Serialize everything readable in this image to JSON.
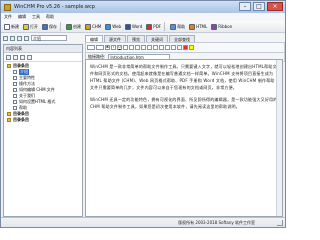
{
  "window": {
    "title": "WinCHM Pro v5.26 - sample.wcp"
  },
  "menu": [
    "文件",
    "编辑",
    "工具",
    "帮助"
  ],
  "toolbar": [
    "新建",
    "打开",
    "保存",
    "",
    "创建",
    "CHM",
    "Web",
    "Word",
    "PDF",
    "",
    "帮助",
    "HTML",
    "Ribbon"
  ],
  "sub_toolbar": {
    "address_value": "介绍"
  },
  "left_panel": {
    "title": "内容列表",
    "tree": [
      {
        "label": "目录条目",
        "type": "folder",
        "level": 0,
        "bold": true
      },
      {
        "label": "介绍",
        "type": "page",
        "level": 1,
        "selected": true
      },
      {
        "label": "主要特性",
        "type": "page",
        "level": 1
      },
      {
        "label": "操作方法",
        "type": "page",
        "level": 1
      },
      {
        "label": "如何编辑 CHM 文件",
        "type": "page",
        "level": 1
      },
      {
        "label": "关于我们",
        "type": "page",
        "level": 1
      },
      {
        "label": "如何设置HTML 格式",
        "type": "page",
        "level": 1
      },
      {
        "label": "帮助",
        "type": "page",
        "level": 1
      },
      {
        "label": "目录条目",
        "type": "folder",
        "level": 0,
        "bold": true
      },
      {
        "label": "目录条目",
        "type": "folder",
        "level": 0,
        "bold": true
      }
    ]
  },
  "tabs": [
    "编辑",
    "源文件",
    "预览",
    "关键词",
    "全部查找"
  ],
  "address": {
    "label": "链接路径:",
    "value": "Introduction.htm"
  },
  "editor": {
    "paragraphs": [
      "WinCHM 是一款非常简单的帮助文件制作工具。只需要键入文字，就可以轻松地创建出HTML帮助文件和网页形式的文档，使用起来就像是在编写普通文档一样简单。WinCHM 支持将项目直接生成为 HTML 帮助文件 (CHM)、Web 网页格式帮助、PDF 手册和 Word 文档，使用 WinCHM 制作帮助文件只需要简单的几步，文件内容可以来自于您现有的文档或网页，非常方便。",
      "WinCHM 还具一定的功能特色，拥有可视化的界面、所见即所得的编辑器，是一款功能强大又好用的 CHM 帮助文件制作工具，如果您是初次使用本软件，请先阅读这里的帮助说明。"
    ]
  },
  "status": {
    "text": "版权所有 2003-2018 Softany 软件工作室"
  },
  "colors": {
    "selection": "#316ac5",
    "folder": "#e9c24b"
  }
}
